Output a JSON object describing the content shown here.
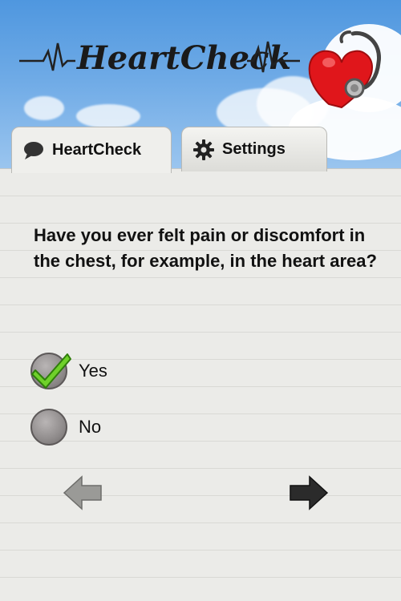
{
  "header": {
    "logo_text": "HeartCheck"
  },
  "tabs": [
    {
      "label": "HeartCheck",
      "icon": "speech-bubble-icon",
      "active": true
    },
    {
      "label": "Settings",
      "icon": "gear-icon",
      "active": false
    }
  ],
  "question": "Have you ever felt pain or discomfort in the chest, for example, in the heart area?",
  "options": [
    {
      "label": "Yes",
      "selected": true
    },
    {
      "label": "No",
      "selected": false
    }
  ],
  "nav": {
    "back_icon": "arrow-left-icon",
    "next_icon": "arrow-right-icon"
  },
  "colors": {
    "sky": "#5a9de2",
    "check": "#6fd12a",
    "heart": "#e0161b",
    "paper": "#ebebe8"
  }
}
